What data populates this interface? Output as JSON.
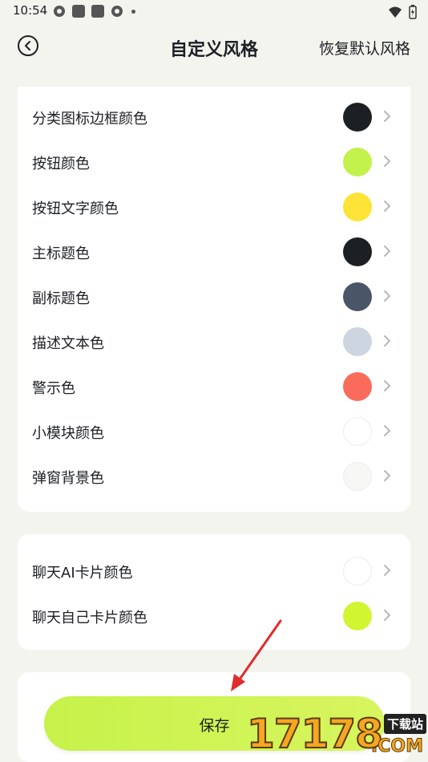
{
  "status_bar": {
    "time": "10:54"
  },
  "header": {
    "title": "自定义风格",
    "reset_label": "恢复默认风格"
  },
  "colors": {
    "accent": "#c7f24a",
    "chevron": "#b5b8bd"
  },
  "card1": {
    "items": [
      {
        "label": "分类图标边框颜色",
        "color": "#1c1f24"
      },
      {
        "label": "按钮颜色",
        "color": "#c3f24c"
      },
      {
        "label": "按钮文字颜色",
        "color": "#fde336"
      },
      {
        "label": "主标题色",
        "color": "#1c1f24"
      },
      {
        "label": "副标题色",
        "color": "#4b5568"
      },
      {
        "label": "描述文本色",
        "color": "#cdd5e0"
      },
      {
        "label": "警示色",
        "color": "#fb6b5c"
      },
      {
        "label": "小模块颜色",
        "color": "#ffffff"
      },
      {
        "label": "弹窗背景色",
        "color": "#f7f7f5"
      }
    ]
  },
  "card2": {
    "items": [
      {
        "label": "聊天AI卡片颜色",
        "color": "#ffffff"
      },
      {
        "label": "聊天自己卡片颜色",
        "color": "#d2f531"
      }
    ]
  },
  "save_button": {
    "label": "保存"
  },
  "watermark": {
    "digits": "17178",
    "tag": "下载站",
    "domain": ".COM"
  }
}
